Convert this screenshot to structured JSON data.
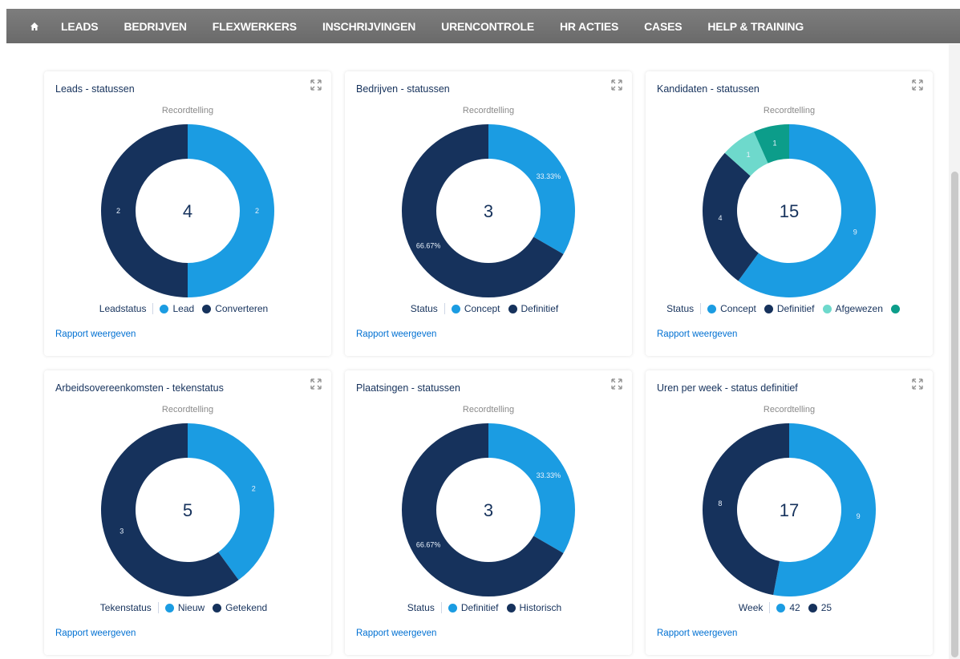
{
  "nav": {
    "items": [
      "LEADS",
      "BEDRIJVEN",
      "FLEXWERKERS",
      "INSCHRIJVINGEN",
      "URENCONTROLE",
      "HR ACTIES",
      "CASES",
      "HELP & TRAINING"
    ]
  },
  "cards": [
    {
      "title": "Leads - statussen",
      "subtitle": "Recordtelling",
      "total": "4",
      "legend_title": "Leadstatus",
      "legend": [
        "Lead",
        "Converteren"
      ],
      "link": "Rapport weergeven"
    },
    {
      "title": "Bedrijven - statussen",
      "subtitle": "Recordtelling",
      "total": "3",
      "legend_title": "Status",
      "legend": [
        "Concept",
        "Definitief"
      ],
      "link": "Rapport weergeven"
    },
    {
      "title": "Kandidaten - statussen",
      "subtitle": "Recordtelling",
      "total": "15",
      "legend_title": "Status",
      "legend": [
        "Concept",
        "Definitief",
        "Afgewezen",
        ""
      ],
      "link": "Rapport weergeven"
    },
    {
      "title": "Arbeidsovereenkomsten - tekenstatus",
      "subtitle": "Recordtelling",
      "total": "5",
      "legend_title": "Tekenstatus",
      "legend": [
        "Nieuw",
        "Getekend"
      ],
      "link": "Rapport weergeven"
    },
    {
      "title": "Plaatsingen - statussen",
      "subtitle": "Recordtelling",
      "total": "3",
      "legend_title": "Status",
      "legend": [
        "Definitief",
        "Historisch"
      ],
      "link": "Rapport weergeven"
    },
    {
      "title": "Uren per week - status definitief",
      "subtitle": "Recordtelling",
      "total": "17",
      "legend_title": "Week",
      "legend": [
        "42",
        "25"
      ],
      "link": "Rapport weergeven"
    }
  ],
  "colors": {
    "light_blue": "#1b9ce2",
    "dark_navy": "#16325c",
    "mint": "#6ed9cc",
    "teal": "#0c9d8a",
    "nav_bg": "#737373"
  },
  "chart_data": [
    {
      "type": "pie",
      "title": "Leads - statussen",
      "subtitle": "Recordtelling",
      "categories": [
        "Lead",
        "Converteren"
      ],
      "values": [
        2,
        2
      ],
      "labels": [
        "2",
        "2"
      ],
      "colors": [
        "#1b9ce2",
        "#16325c"
      ],
      "legend_title": "Leadstatus",
      "total": 4
    },
    {
      "type": "pie",
      "title": "Bedrijven - statussen",
      "subtitle": "Recordtelling",
      "categories": [
        "Concept",
        "Definitief"
      ],
      "values": [
        1,
        2
      ],
      "labels": [
        "33.33%",
        "66.67%"
      ],
      "colors": [
        "#1b9ce2",
        "#16325c"
      ],
      "legend_title": "Status",
      "total": 3
    },
    {
      "type": "pie",
      "title": "Kandidaten - statussen",
      "subtitle": "Recordtelling",
      "categories": [
        "Concept",
        "Definitief",
        "Afgewezen",
        ""
      ],
      "values": [
        9,
        4,
        1,
        1
      ],
      "labels": [
        "9",
        "4",
        "1",
        "1"
      ],
      "colors": [
        "#1b9ce2",
        "#16325c",
        "#6ed9cc",
        "#0c9d8a"
      ],
      "legend_title": "Status",
      "total": 15
    },
    {
      "type": "pie",
      "title": "Arbeidsovereenkomsten - tekenstatus",
      "subtitle": "Recordtelling",
      "categories": [
        "Nieuw",
        "Getekend"
      ],
      "values": [
        2,
        3
      ],
      "labels": [
        "2",
        "3"
      ],
      "colors": [
        "#1b9ce2",
        "#16325c"
      ],
      "legend_title": "Tekenstatus",
      "total": 5
    },
    {
      "type": "pie",
      "title": "Plaatsingen - statussen",
      "subtitle": "Recordtelling",
      "categories": [
        "Definitief",
        "Historisch"
      ],
      "values": [
        1,
        2
      ],
      "labels": [
        "33.33%",
        "66.67%"
      ],
      "colors": [
        "#1b9ce2",
        "#16325c"
      ],
      "legend_title": "Status",
      "total": 3
    },
    {
      "type": "pie",
      "title": "Uren per week - status definitief",
      "subtitle": "Recordtelling",
      "categories": [
        "42",
        "25"
      ],
      "values": [
        9,
        8
      ],
      "labels": [
        "9",
        "8"
      ],
      "colors": [
        "#1b9ce2",
        "#16325c"
      ],
      "legend_title": "Week",
      "total": 17
    }
  ]
}
